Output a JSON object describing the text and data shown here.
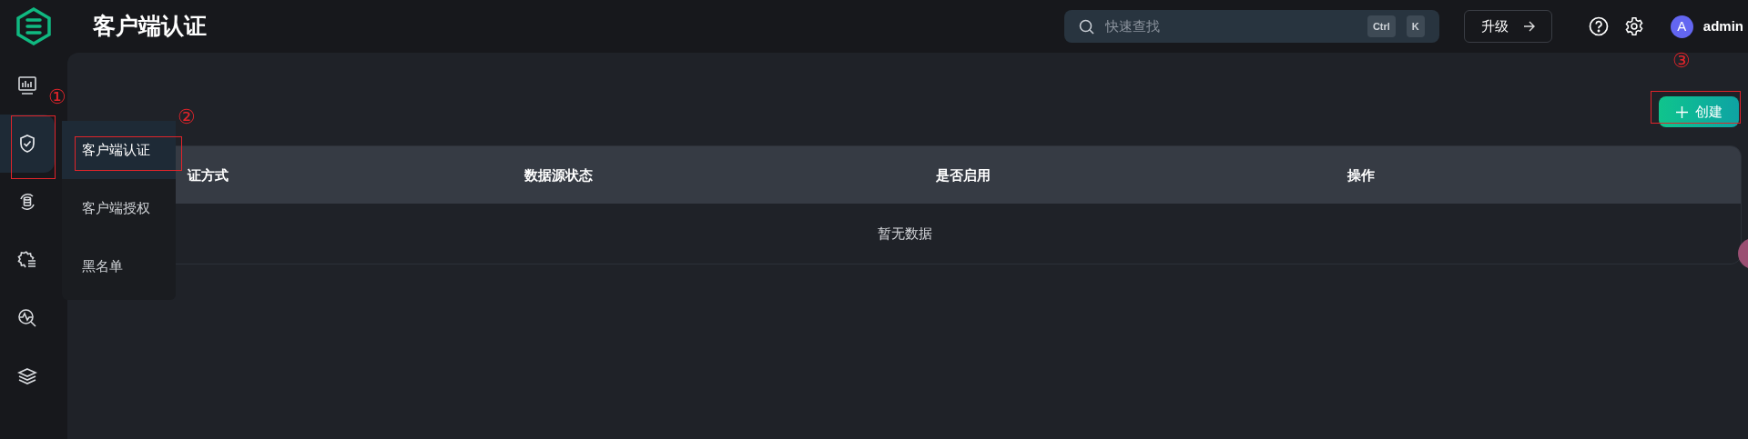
{
  "header": {
    "title": "客户端认证",
    "search": {
      "placeholder": "快速查找",
      "keys": [
        "Ctrl",
        "K"
      ]
    },
    "upgrade_button": "升级",
    "user": {
      "avatar": "A",
      "name": "admin"
    }
  },
  "sidebar": {
    "items": [
      {
        "selected": false
      },
      {
        "selected": true
      },
      {
        "selected": false
      },
      {
        "selected": false
      },
      {
        "selected": false
      },
      {
        "selected": false
      }
    ]
  },
  "submenu": {
    "items": [
      {
        "label": "客户端认证",
        "selected": true
      },
      {
        "label": "客户端授权",
        "selected": false
      },
      {
        "label": "黑名单",
        "selected": false
      }
    ]
  },
  "create_button": "创建",
  "table": {
    "columns": [
      "证方式",
      "数据源状态",
      "是否启用",
      "操作"
    ],
    "empty_text": "暂无数据"
  },
  "annotations": [
    "①",
    "②",
    "③"
  ]
}
